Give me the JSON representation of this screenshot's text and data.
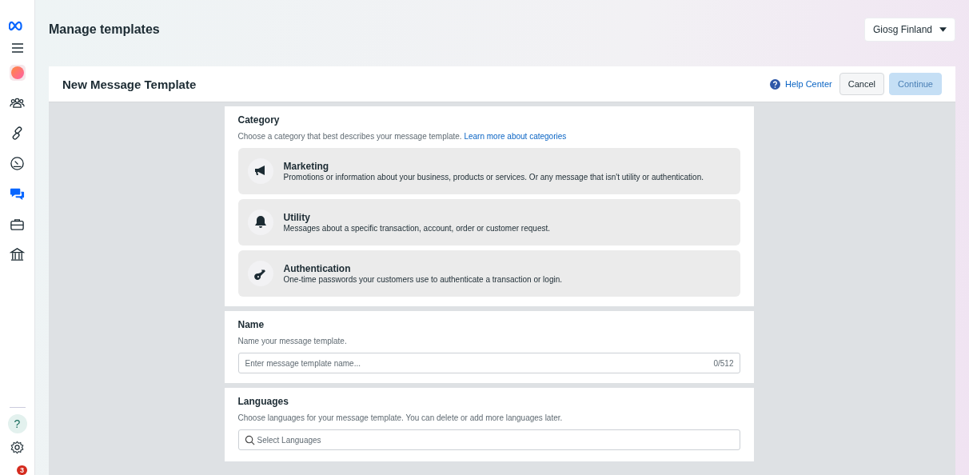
{
  "sidebar": {
    "items": [
      {
        "kind": "people",
        "selected": false
      },
      {
        "kind": "link",
        "selected": false
      },
      {
        "kind": "gauge",
        "selected": false
      },
      {
        "kind": "chat",
        "selected": true
      },
      {
        "kind": "briefcase",
        "selected": false
      },
      {
        "kind": "bank",
        "selected": false
      }
    ],
    "notification_badge": "3",
    "help": "?"
  },
  "header": {
    "title": "Manage templates",
    "account": "Giosg Finland"
  },
  "panel": {
    "title": "New Message Template",
    "help_link": "Help Center",
    "buttons": [
      {
        "label": "Cancel",
        "kind": "secondary",
        "disabled": false
      },
      {
        "label": "Continue",
        "kind": "primary",
        "disabled": true
      }
    ]
  },
  "category": {
    "title": "Category",
    "description": "Choose a category that best describes your message template.",
    "link": "Learn more about categories",
    "options": [
      {
        "kind": "megaphone",
        "title": "Marketing",
        "description": "Promotions or information about your business, products or services. Or any message that isn't utility or authentication."
      },
      {
        "kind": "bell",
        "title": "Utility",
        "description": "Messages about a specific transaction, account, order or customer request."
      },
      {
        "kind": "key",
        "title": "Authentication",
        "description": "One-time passwords your customers use to authenticate a transaction or login."
      }
    ]
  },
  "name": {
    "title": "Name",
    "description": "Name your message template.",
    "placeholder": "Enter message template name...",
    "counter": "0/512"
  },
  "languages": {
    "title": "Languages",
    "description": "Choose languages for your message template. You can delete or add more languages later.",
    "placeholder": "Select Languages"
  }
}
